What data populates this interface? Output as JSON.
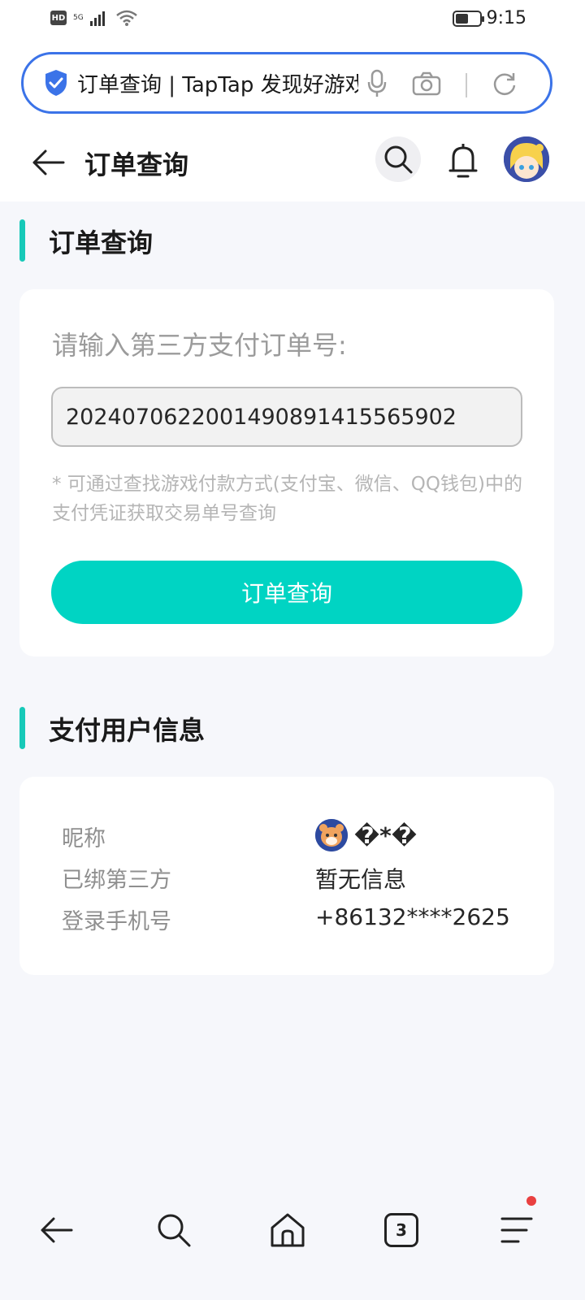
{
  "status_bar": {
    "hd": "HD",
    "network": "5G",
    "time": "9:15",
    "battery_level": 0.55
  },
  "browser": {
    "url_title": "订单查询 | TapTap 发现好游戏",
    "icons": [
      "shield-icon",
      "mic-icon",
      "camera-icon",
      "refresh-icon"
    ]
  },
  "header": {
    "title": "订单查询"
  },
  "order_section": {
    "title": "订单查询",
    "label": "请输入第三方支付订单号:",
    "order_number": "2024070622001490891415565902",
    "hint": "* 可通过查找游戏付款方式(支付宝、微信、QQ钱包)中的支付凭证获取交易单号查询",
    "button": "订单查询"
  },
  "user_section": {
    "title": "支付用户信息",
    "rows": [
      {
        "label": "昵称",
        "value": "�*�"
      },
      {
        "label": "已绑第三方",
        "value": "暂无信息"
      },
      {
        "label": "登录手机号",
        "value": "+86132****2625"
      }
    ]
  },
  "bottom_nav": {
    "tab_count": "3",
    "accent_color": "#00d4c3",
    "notify_dot_color": "#e94040"
  }
}
